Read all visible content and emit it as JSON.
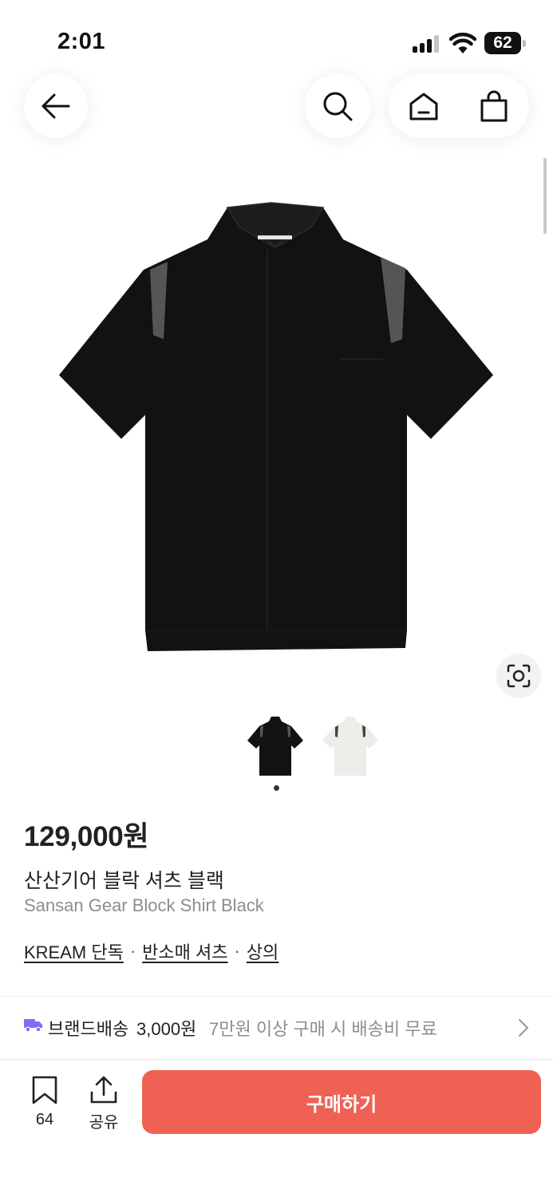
{
  "status_bar": {
    "time": "2:01",
    "battery": "62"
  },
  "nav": {
    "back_icon": "arrow-left-icon",
    "search_icon": "search-icon",
    "home_icon": "home-icon",
    "cart_icon": "shopping-bag-icon"
  },
  "gallery": {
    "thumbnails": [
      {
        "color": "#111111",
        "selected": true
      },
      {
        "color": "#eeeeea",
        "selected": false
      }
    ]
  },
  "product": {
    "price": "129,000원",
    "name_ko": "산산기어 블락 셔츠 블랙",
    "name_en": "Sansan Gear Block Shirt Black",
    "tags": [
      "KREAM 단독",
      "반소매 셔츠",
      "상의"
    ],
    "tag_separator": "·"
  },
  "shipping": {
    "label": "브랜드배송",
    "price": "3,000원",
    "note": "7만원 이상 구매 시 배송비 무료",
    "icon": "truck-icon"
  },
  "bottom_bar": {
    "bookmark_count": "64",
    "share_label": "공유",
    "buy_label": "구매하기",
    "buy_color": "#ef6253"
  }
}
